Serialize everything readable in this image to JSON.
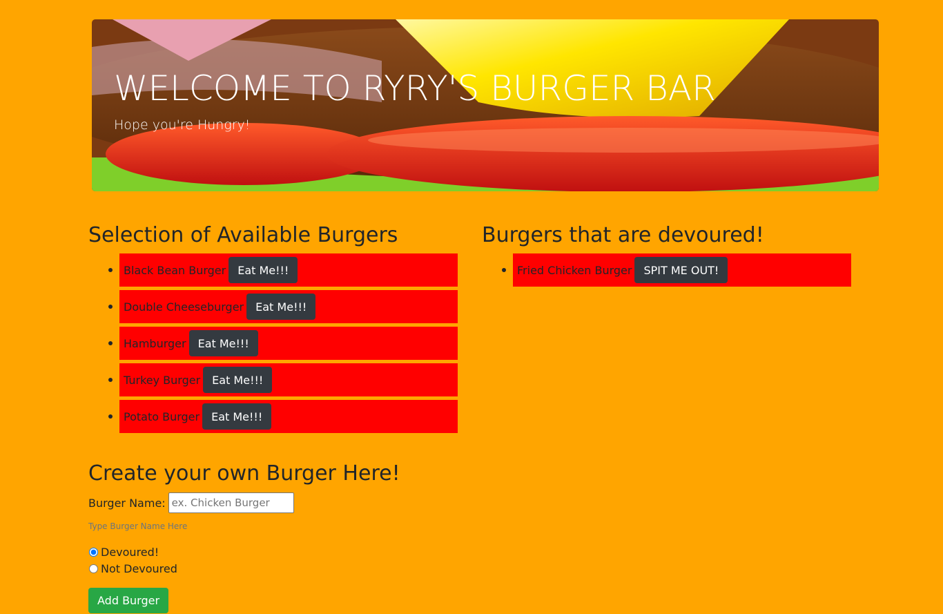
{
  "hero": {
    "title": "WELCOME TO RYRY'S BURGER BAR",
    "subtitle": "Hope you're Hungry!"
  },
  "available": {
    "heading": "Selection of Available Burgers",
    "items": [
      {
        "name": "Black Bean Burger",
        "button": "Eat Me!!!"
      },
      {
        "name": "Double Cheeseburger",
        "button": "Eat Me!!!"
      },
      {
        "name": "Hamburger",
        "button": "Eat Me!!!"
      },
      {
        "name": "Turkey Burger",
        "button": "Eat Me!!!"
      },
      {
        "name": "Potato Burger",
        "button": "Eat Me!!!"
      }
    ]
  },
  "devoured": {
    "heading": "Burgers that are devoured!",
    "items": [
      {
        "name": "Fried Chicken Burger",
        "button": "SPIT ME OUT!"
      }
    ]
  },
  "create": {
    "heading": "Create your own Burger Here!",
    "name_label": "Burger Name:",
    "name_value": "",
    "name_placeholder": "ex. Chicken Burger",
    "help_text": "Type Burger Name Here",
    "radio_devoured_label": "Devoured!",
    "radio_not_devoured_label": "Not Devoured",
    "selected_radio": "devoured",
    "submit_label": "Add Burger"
  },
  "colors": {
    "page_background": "#ffa500",
    "list_item_background": "#ff0000",
    "dark_button": "#343a40",
    "success_button": "#28a745"
  }
}
